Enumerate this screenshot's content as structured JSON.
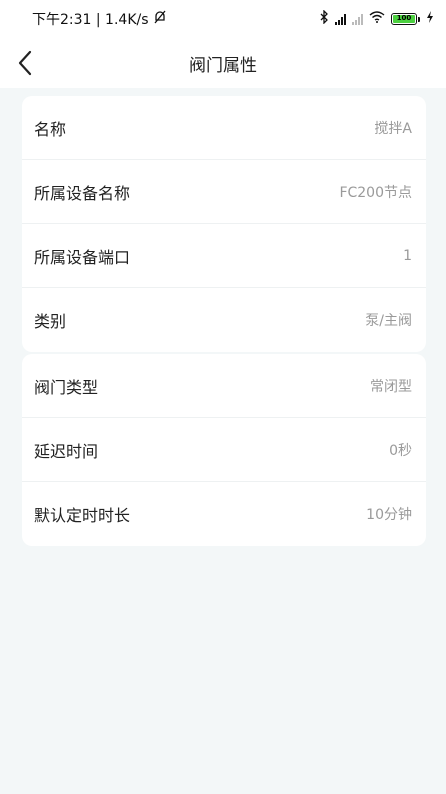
{
  "status_bar": {
    "time_speed": "下午2:31 | 1.4K/s",
    "battery": "100"
  },
  "nav": {
    "title": "阀门属性"
  },
  "card1": {
    "rows": [
      {
        "label": "名称",
        "value": "搅拌A"
      },
      {
        "label": "所属设备名称",
        "value": "FC200节点"
      },
      {
        "label": "所属设备端口",
        "value": "1"
      },
      {
        "label": "类别",
        "value": "泵/主阀"
      }
    ]
  },
  "card2": {
    "rows": [
      {
        "label": "阀门类型",
        "value": "常闭型"
      },
      {
        "label": "延迟时间",
        "value": "0秒"
      },
      {
        "label": "默认定时时长",
        "value": "10分钟"
      }
    ]
  }
}
